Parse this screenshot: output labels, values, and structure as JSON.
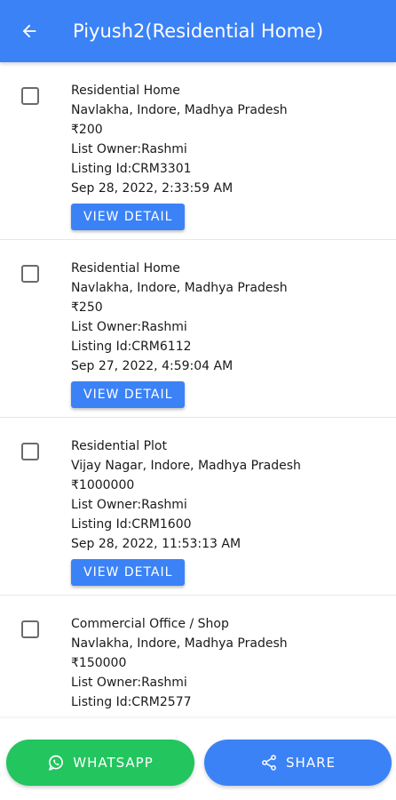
{
  "header": {
    "title": "Piyush2(Residential Home)",
    "back_icon": "arrow-back-icon"
  },
  "listings": [
    {
      "type": "Residential Home",
      "location": "Navlakha, Indore, Madhya Pradesh",
      "price": "₹200",
      "owner": "List Owner:Rashmi",
      "listing_id": "Listing Id:CRM3301",
      "date": "Sep 28, 2022, 2:33:59 AM",
      "button": "VIEW DETAIL"
    },
    {
      "type": "Residential Home",
      "location": "Navlakha, Indore, Madhya Pradesh",
      "price": "₹250",
      "owner": "List Owner:Rashmi",
      "listing_id": "Listing Id:CRM6112",
      "date": "Sep 27, 2022, 4:59:04 AM",
      "button": "VIEW DETAIL"
    },
    {
      "type": "Residential Plot",
      "location": "Vijay Nagar, Indore, Madhya Pradesh",
      "price": "₹1000000",
      "owner": "List Owner:Rashmi",
      "listing_id": "Listing Id:CRM1600",
      "date": "Sep 28, 2022, 11:53:13 AM",
      "button": "VIEW DETAIL"
    },
    {
      "type": "Commercial Office / Shop",
      "location": "Navlakha, Indore, Madhya Pradesh",
      "price": "₹150000",
      "owner": "List Owner:Rashmi",
      "listing_id": "Listing Id:CRM2577",
      "date": "",
      "button": ""
    }
  ],
  "footer": {
    "whatsapp_label": "WHATSAPP",
    "whatsapp_icon": "whatsapp-icon",
    "share_label": "SHARE",
    "share_icon": "share-icon"
  },
  "colors": {
    "primary": "#3b82f6",
    "whatsapp": "#22c55e"
  }
}
